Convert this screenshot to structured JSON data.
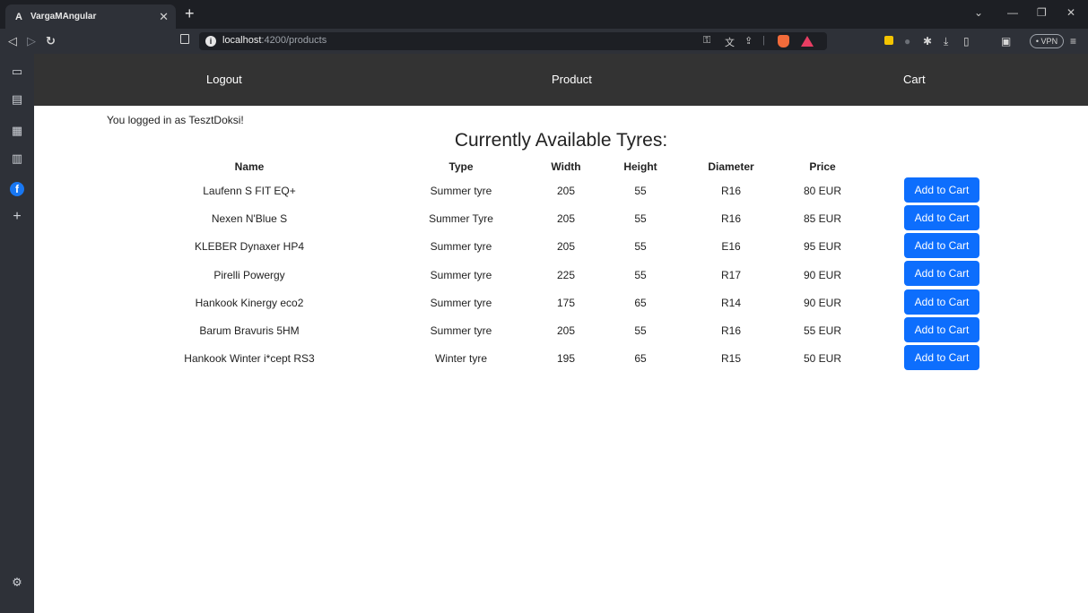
{
  "browser": {
    "tab_title": "VargaMAngular",
    "tab_favicon": "A",
    "url_host": "localhost",
    "url_path": ":4200/products",
    "vpn_label": "• VPN"
  },
  "nav": {
    "logout": "Logout",
    "product": "Product",
    "cart": "Cart"
  },
  "login_message": "You logged in as TesztDoksi!",
  "title": "Currently Available Tyres:",
  "table": {
    "headers": [
      "Name",
      "Type",
      "Width",
      "Height",
      "Diameter",
      "Price"
    ],
    "rows": [
      {
        "name": "Laufenn S FIT EQ+",
        "type": "Summer tyre",
        "width": "205",
        "height": "55",
        "diameter": "R16",
        "price": "80 EUR"
      },
      {
        "name": "Nexen N'Blue S",
        "type": "Summer Tyre",
        "width": "205",
        "height": "55",
        "diameter": "R16",
        "price": "85 EUR"
      },
      {
        "name": "KLEBER Dynaxer HP4",
        "type": "Summer tyre",
        "width": "205",
        "height": "55",
        "diameter": "E16",
        "price": "95 EUR"
      },
      {
        "name": "Pirelli Powergy",
        "type": "Summer tyre",
        "width": "225",
        "height": "55",
        "diameter": "R17",
        "price": "90 EUR"
      },
      {
        "name": "Hankook Kinergy eco2",
        "type": "Summer tyre",
        "width": "175",
        "height": "65",
        "diameter": "R14",
        "price": "90 EUR"
      },
      {
        "name": "Barum Bravuris 5HM",
        "type": "Summer tyre",
        "width": "205",
        "height": "55",
        "diameter": "R16",
        "price": "55 EUR"
      },
      {
        "name": "Hankook Winter i*cept RS3",
        "type": "Winter tyre",
        "width": "195",
        "height": "65",
        "diameter": "R15",
        "price": "50 EUR"
      }
    ],
    "button_label": "Add to Cart"
  },
  "colors": {
    "nav_bg": "#333333",
    "button_bg": "#0d6efd"
  }
}
